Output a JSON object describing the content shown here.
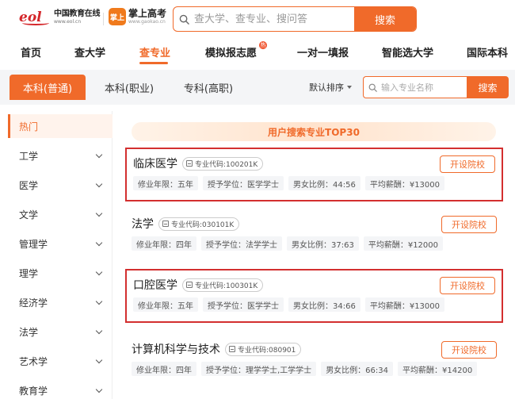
{
  "header": {
    "eol_logo": {
      "mark": "eol",
      "cn": "中国教育在线",
      "en": "www.eol.cn"
    },
    "zsgk_logo": {
      "mark": "掌上",
      "cn": "掌上高考",
      "en": "www.gaokao.cn"
    },
    "search": {
      "placeholder": "查大学、查专业、搜问答",
      "button_label": "搜索"
    }
  },
  "nav": {
    "items": [
      "首页",
      "查大学",
      "查专业",
      "模拟报志愿",
      "一对一填报",
      "智能选大学",
      "国际本科"
    ],
    "active_index": 2,
    "hot_badge": "热"
  },
  "filter": {
    "tabs": [
      "本科(普通)",
      "本科(职业)",
      "专科(高职)"
    ],
    "active_index": 0,
    "sort_label": "默认排序",
    "search_placeholder": "输入专业名称",
    "search_button": "搜索"
  },
  "sidebar": {
    "items": [
      "热门",
      "工学",
      "医学",
      "文学",
      "管理学",
      "理学",
      "经济学",
      "法学",
      "艺术学",
      "教育学"
    ],
    "active_index": 0
  },
  "main": {
    "banner": "用户搜索专业TOP30",
    "cards": [
      {
        "name": "临床医学",
        "code": "专业代码:100201K",
        "years": "修业年限：五年",
        "degree": "授予学位：医学学士",
        "ratio": "男女比例：44:56",
        "salary": "平均薪酬：¥13000",
        "button": "开设院校",
        "highlight": true
      },
      {
        "name": "法学",
        "code": "专业代码:030101K",
        "years": "修业年限：四年",
        "degree": "授予学位：法学学士",
        "ratio": "男女比例：37:63",
        "salary": "平均薪酬：¥12000",
        "button": "开设院校",
        "highlight": false
      },
      {
        "name": "口腔医学",
        "code": "专业代码:100301K",
        "years": "修业年限：五年",
        "degree": "授予学位：医学学士",
        "ratio": "男女比例：34:66",
        "salary": "平均薪酬：¥13000",
        "button": "开设院校",
        "highlight": true
      },
      {
        "name": "计算机科学与技术",
        "code": "专业代码:080901",
        "years": "修业年限：四年",
        "degree": "授予学位：理学学士,工学学士",
        "ratio": "男女比例：66:34",
        "salary": "平均薪酬：¥14200",
        "button": "开设院校",
        "highlight": false
      }
    ]
  },
  "colors": {
    "accent": "#f06a2a",
    "highlight_border": "#d32f2f"
  },
  "icons": {
    "search": "magnifier-icon",
    "code": "id-card-icon",
    "chevron": "chevron-down-icon"
  }
}
